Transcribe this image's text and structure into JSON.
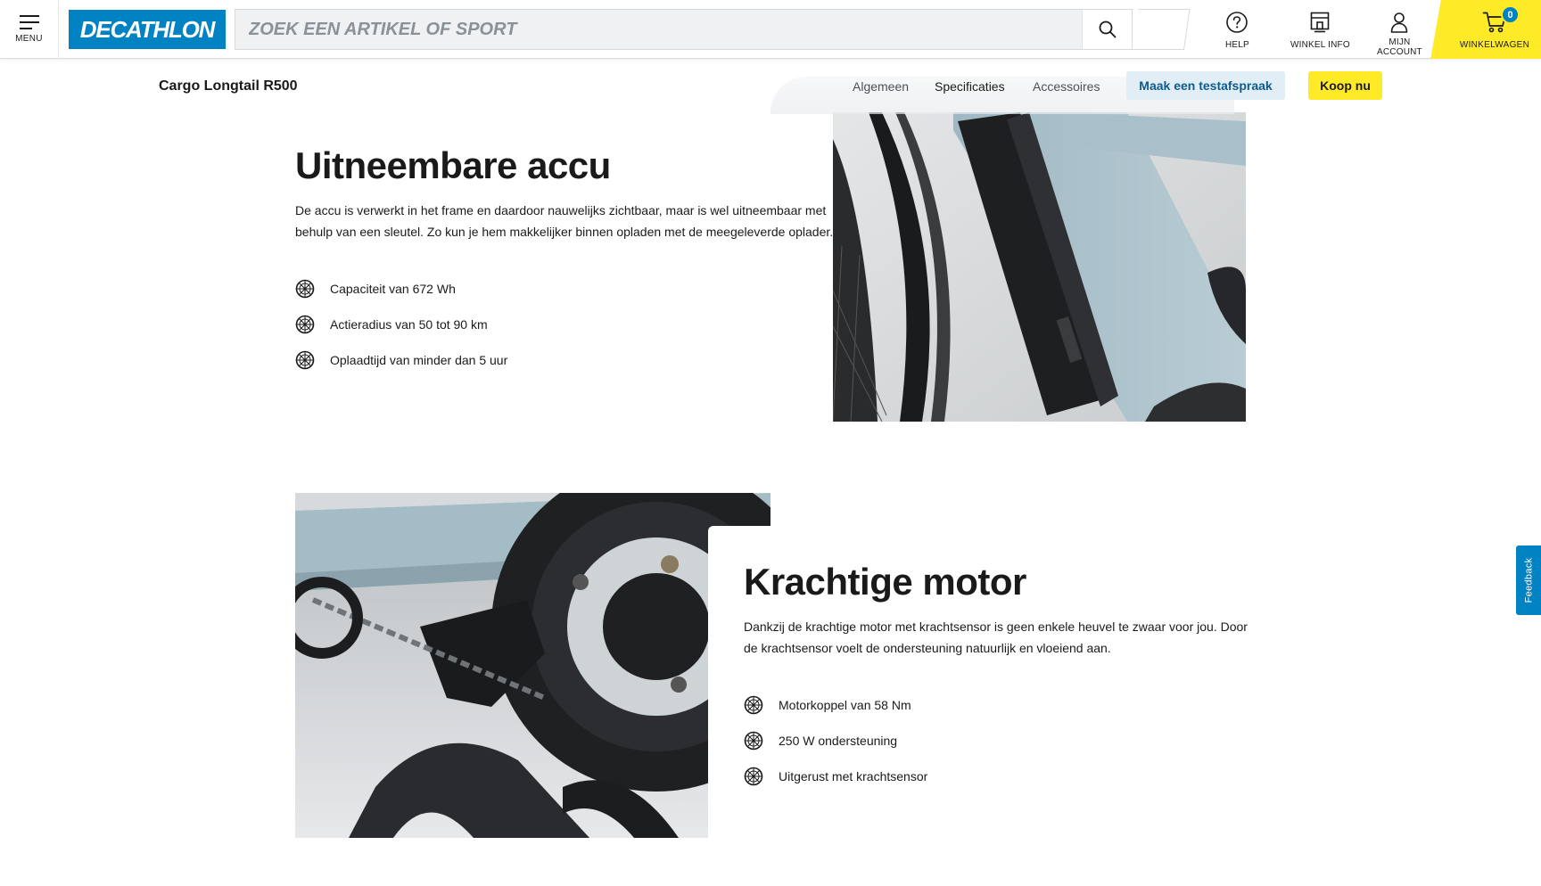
{
  "header": {
    "menu_label": "MENU",
    "logo_text": "DECATHLON",
    "search_placeholder": "ZOEK EEN ARTIKEL OF SPORT",
    "help_label": "HELP",
    "store_label": "WINKEL INFO",
    "account_label_1": "MIJN",
    "account_label_2": "ACCOUNT",
    "cart_label": "WINKELWAGEN",
    "cart_count": "0",
    "brand_color": "#0082c3",
    "accent_color": "#ffea28"
  },
  "subnav": {
    "product_title": "Cargo Longtail R500",
    "tabs": [
      {
        "label": "Algemeen"
      },
      {
        "label": "Specificaties"
      },
      {
        "label": "Accessoires"
      }
    ],
    "test_button": "Maak een testafspraak",
    "buy_button": "Koop nu"
  },
  "sections": [
    {
      "title": "Uitneembare accu",
      "body_line_1": "De accu is verwerkt in het frame en daardoor nauwelijks zichtbaar, maar is wel uitneembaar met",
      "body_line_2": "behulp van een sleutel. Zo kun je hem makkelijker binnen opladen met de meegeleverde oplader.",
      "features": [
        {
          "icon": "wheel-icon",
          "label": "Capaciteit van 672 Wh"
        },
        {
          "icon": "wheel-icon",
          "label": "Actieradius van 50 tot 90 km"
        },
        {
          "icon": "wheel-icon",
          "label": "Oplaadtijd van minder dan 5 uur"
        }
      ]
    },
    {
      "title": "Krachtige motor",
      "body_line_1": "Dankzij de krachtige motor met krachtsensor is geen enkele heuvel te zwaar voor jou. Door",
      "body_line_2": "de krachtsensor voelt de ondersteuning natuurlijk en vloeiend aan.",
      "features": [
        {
          "icon": "wheel-icon",
          "label": "Motorkoppel van 58 Nm"
        },
        {
          "icon": "wheel-icon",
          "label": "250 W ondersteuning"
        },
        {
          "icon": "wheel-icon",
          "label": "Uitgerust met krachtsensor"
        }
      ]
    }
  ],
  "feedback_label": "Feedback"
}
